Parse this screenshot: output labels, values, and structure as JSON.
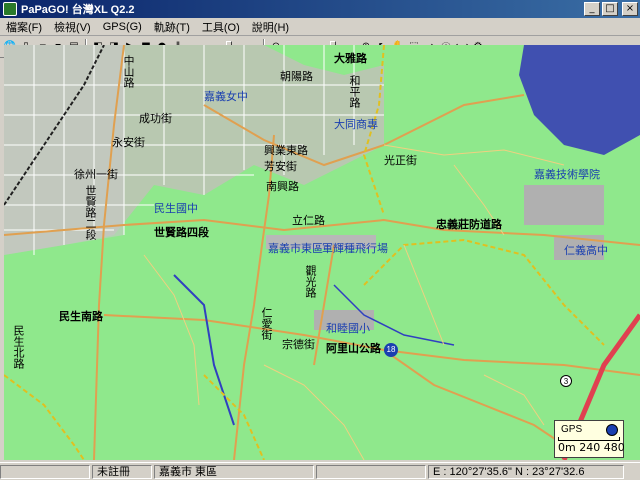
{
  "window": {
    "title": "PaPaGO! 台灣XL Q2.2",
    "min_glyph": "_",
    "max_glyph": "□",
    "close_glyph": "×"
  },
  "menu": [
    {
      "label": "檔案(F)"
    },
    {
      "label": "檢視(V)"
    },
    {
      "label": "GPS(G)"
    },
    {
      "label": "軌跡(T)"
    },
    {
      "label": "工具(O)"
    },
    {
      "label": "說明(H)"
    }
  ],
  "toolbar": {
    "icons": [
      "globe-icon",
      "new-icon",
      "open-icon",
      "save-icon",
      "print-icon",
      "back-icon",
      "forward-icon",
      "play-icon",
      "stop-icon",
      "record-icon",
      "pause-icon"
    ],
    "right_icons": [
      "zoom-out-icon",
      "zoom-in-icon",
      "pointer-icon",
      "hand-icon",
      "select-icon",
      "route-icon",
      "info-icon",
      "measure-icon",
      "settings-icon"
    ],
    "track_slider_value": 0.6,
    "zoom_slider_value": 0.7
  },
  "map": {
    "labels": [
      {
        "text": "大雅路",
        "name": "label-daya-road",
        "style": "bold"
      },
      {
        "text": "嘉義女中",
        "name": "label-chiayi-girls-hs",
        "style": "blue"
      },
      {
        "text": "大同商專",
        "name": "label-datong-college",
        "style": "blue"
      },
      {
        "text": "嘉義技術學院",
        "name": "label-chiayi-tech",
        "style": "blue"
      },
      {
        "text": "民生國中",
        "name": "label-minsheng-jhs",
        "style": "blue"
      },
      {
        "text": "世賢路四段",
        "name": "label-shixian-road",
        "style": "bold"
      },
      {
        "text": "嘉義市東區",
        "name": "label-east-district",
        "style": "blue"
      },
      {
        "text": "軍輝種飛行場",
        "name": "label-airfield",
        "style": "blue"
      },
      {
        "text": "忠義莊防道路",
        "name": "label-zhongyi-road",
        "style": "bold"
      },
      {
        "text": "仁義高中",
        "name": "label-renyi-hs",
        "style": "blue"
      },
      {
        "text": "民生南路",
        "name": "label-minsheng-s-road",
        "style": "bold"
      },
      {
        "text": "和睦國小",
        "name": "label-hemu-es",
        "style": "blue"
      },
      {
        "text": "阿里山公路",
        "name": "label-alishan-highway",
        "style": "bold"
      },
      {
        "text": "興業東路",
        "name": "label-xingye-e-road",
        "style": "normal"
      },
      {
        "text": "南興路",
        "name": "label-nanxing-road",
        "style": "normal"
      },
      {
        "text": "光正街",
        "name": "label-guangzheng-st",
        "style": "normal"
      },
      {
        "text": "芳安街",
        "name": "label-fangan-st",
        "style": "normal"
      },
      {
        "text": "永安街",
        "name": "label-yongan-st",
        "style": "normal"
      },
      {
        "text": "成功街",
        "name": "label-chenggong-st",
        "style": "normal"
      },
      {
        "text": "徐州一街",
        "name": "label-xuzhou-st",
        "style": "normal"
      },
      {
        "text": "民生北路",
        "name": "label-minsheng-n-road",
        "style": "normal"
      },
      {
        "text": "立仁路",
        "name": "label-liren-road",
        "style": "normal"
      },
      {
        "text": "觀光路",
        "name": "label-guanguang-road",
        "style": "normal"
      },
      {
        "text": "朝陽路",
        "name": "label-chaoyang-road",
        "style": "normal"
      },
      {
        "text": "仁愛街",
        "name": "label-renai-st",
        "style": "normal"
      },
      {
        "text": "宗德街",
        "name": "label-zongde-st",
        "style": "normal"
      },
      {
        "text": "和平路",
        "name": "label-heping-road",
        "style": "normal"
      },
      {
        "text": "世賢路二段",
        "name": "label-shixian-road-2",
        "style": "normal"
      },
      {
        "text": "中山路",
        "name": "label-zhongshan-road",
        "style": "normal"
      }
    ],
    "route_badge": "18",
    "route_badge_2": "3",
    "scale": {
      "text": "0m  240  480",
      "gps_label": "GPS"
    }
  },
  "status": {
    "pane1": "",
    "pane2": "未註冊",
    "pane3": "嘉義市 東區",
    "coords": "E : 120°27'35.6\"  N : 23°27'32.6"
  },
  "colors": {
    "map_bg": "#8fe88c",
    "urban": "#c8c8c8",
    "road_main": "#e0a050",
    "water": "#4050b0",
    "river": "#3040c0",
    "highway": "#e04050",
    "boundary": "#e0c020"
  }
}
